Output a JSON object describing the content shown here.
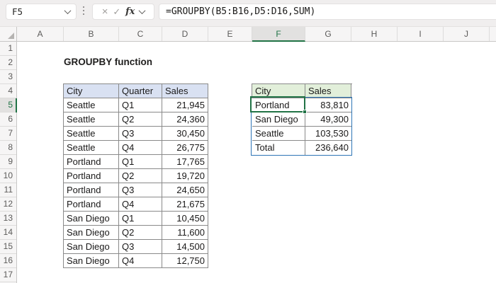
{
  "formula_bar": {
    "name_box": "F5",
    "formula": "=GROUPBY(B5:B16,D5:D16,SUM)",
    "cancel_icon": "×",
    "enter_icon": "✓",
    "fx_icon": "fx"
  },
  "grid": {
    "column_headers": [
      "A",
      "B",
      "C",
      "D",
      "E",
      "F",
      "G",
      "H",
      "I",
      "J"
    ],
    "selected_column": "F",
    "row_headers": [
      1,
      2,
      3,
      4,
      5,
      6,
      7,
      8,
      9,
      10,
      11,
      12,
      13,
      14,
      15,
      16,
      17
    ],
    "selected_row": 5,
    "selected_cell": "F5"
  },
  "sheet": {
    "title": "GROUPBY function",
    "main_table": {
      "headers": [
        "City",
        "Quarter",
        "Sales"
      ],
      "rows": [
        [
          "Seattle",
          "Q1",
          "21,945"
        ],
        [
          "Seattle",
          "Q2",
          "24,360"
        ],
        [
          "Seattle",
          "Q3",
          "30,450"
        ],
        [
          "Seattle",
          "Q4",
          "26,775"
        ],
        [
          "Portland",
          "Q1",
          "17,765"
        ],
        [
          "Portland",
          "Q2",
          "19,720"
        ],
        [
          "Portland",
          "Q3",
          "24,650"
        ],
        [
          "Portland",
          "Q4",
          "21,675"
        ],
        [
          "San Diego",
          "Q1",
          "10,450"
        ],
        [
          "San Diego",
          "Q2",
          "11,600"
        ],
        [
          "San Diego",
          "Q3",
          "14,500"
        ],
        [
          "San Diego",
          "Q4",
          "12,750"
        ]
      ]
    },
    "result_table": {
      "headers": [
        "City",
        "Sales"
      ],
      "rows": [
        [
          "Portland",
          "83,810"
        ],
        [
          "San Diego",
          "49,300"
        ],
        [
          "Seattle",
          "103,530"
        ],
        [
          "Total",
          "236,640"
        ]
      ],
      "selected_value": "Portland"
    }
  },
  "colors": {
    "selection_green": "#217346",
    "spill_border_blue": "#2e75b6",
    "main_header_fill": "#d9e1f2",
    "result_header_fill": "#e2efda"
  }
}
